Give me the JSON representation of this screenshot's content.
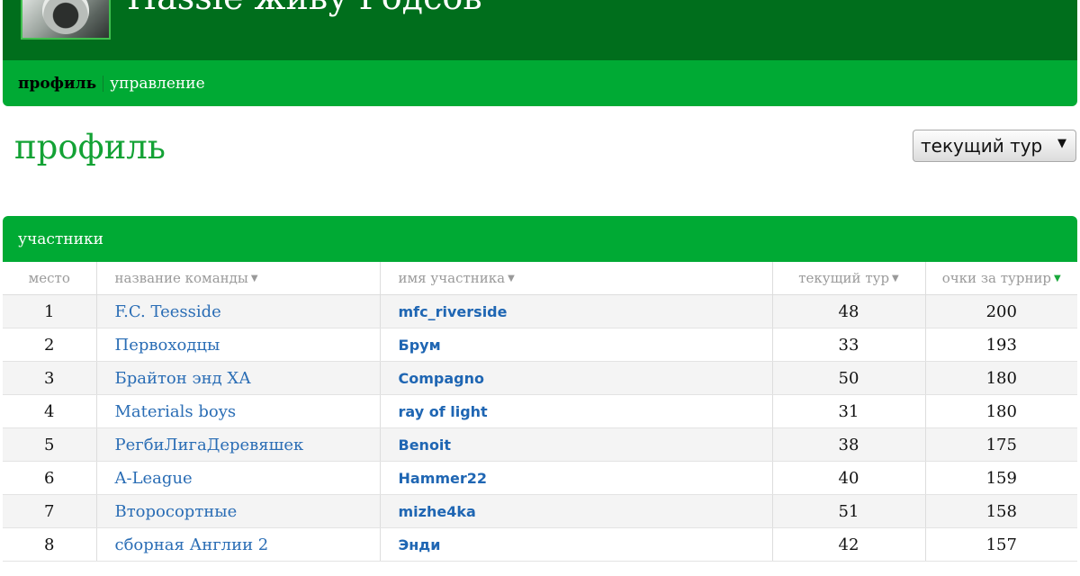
{
  "header": {
    "title": "Hassle живу Годсов",
    "nav": {
      "active": "профиль",
      "link": "управление"
    }
  },
  "page": {
    "title": "профиль",
    "select_value": "текущий тур"
  },
  "panel": {
    "title": "участники",
    "columns": {
      "place": "место",
      "team": "название команды",
      "member": "имя участника",
      "current": "текущий тур",
      "points": "очки за турнир"
    },
    "rows": [
      {
        "place": "1",
        "team": "F.C. Teesside",
        "member": "mfc_riverside",
        "current": "48",
        "points": "200"
      },
      {
        "place": "2",
        "team": "Первоходцы",
        "member": "Брум",
        "current": "33",
        "points": "193"
      },
      {
        "place": "3",
        "team": "Брайтон энд ХА",
        "member": "Compagno",
        "current": "50",
        "points": "180"
      },
      {
        "place": "4",
        "team": "Materials boys",
        "member": "ray of light",
        "current": "31",
        "points": "180"
      },
      {
        "place": "5",
        "team": "РегбиЛигаДеревяшек",
        "member": "Benoit",
        "current": "38",
        "points": "175"
      },
      {
        "place": "6",
        "team": "A-League",
        "member": "Hammer22",
        "current": "40",
        "points": "159"
      },
      {
        "place": "7",
        "team": "Второсортные",
        "member": "mizhe4ka",
        "current": "51",
        "points": "158"
      },
      {
        "place": "8",
        "team": "сборная Англии 2",
        "member": "Энди",
        "current": "42",
        "points": "157"
      }
    ]
  },
  "colors": {
    "dark_green": "#006e1c",
    "green": "#00aa34",
    "link_blue": "#2a6db5"
  }
}
